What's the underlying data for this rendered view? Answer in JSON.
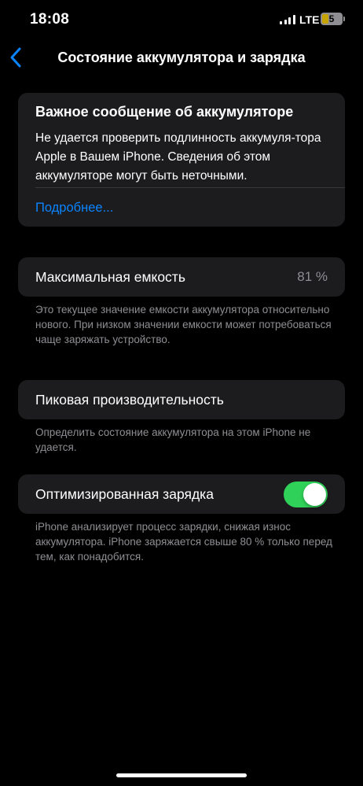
{
  "status_bar": {
    "time": "18:08",
    "network": "LTE",
    "battery_level": "5",
    "icons": [
      "signal-icon",
      "battery-icon"
    ]
  },
  "nav": {
    "title": "Состояние аккумулятора и зарядка",
    "back_icon": "chevron-left-icon"
  },
  "message_card": {
    "title": "Важное сообщение об аккумуляторе",
    "body": "Не удается проверить подлинность аккумуля-тора Apple в Вашем iPhone. Сведения об этом аккумуляторе могут быть неточными.",
    "link": "Подробнее..."
  },
  "max_capacity": {
    "label": "Максимальная емкость",
    "value": "81 %",
    "note": "Это текущее значение емкости аккумулятора относительно нового. При низком значении емкости может потребоваться чаще заряжать устройство."
  },
  "peak_performance": {
    "label": "Пиковая производительность",
    "note": "Определить состояние аккумулятора на этом iPhone не удается."
  },
  "optimized_charging": {
    "label": "Оптимизированная зарядка",
    "enabled": true,
    "note": "iPhone анализирует процесс зарядки, снижая износ аккумулятора. iPhone заряжается свыше 80 % только перед тем, как понадобится."
  },
  "colors": {
    "background": "#000000",
    "card": "#1c1c1e",
    "link": "#0a84ff",
    "toggle_on": "#30d158",
    "secondary_text": "#8e8e93"
  }
}
